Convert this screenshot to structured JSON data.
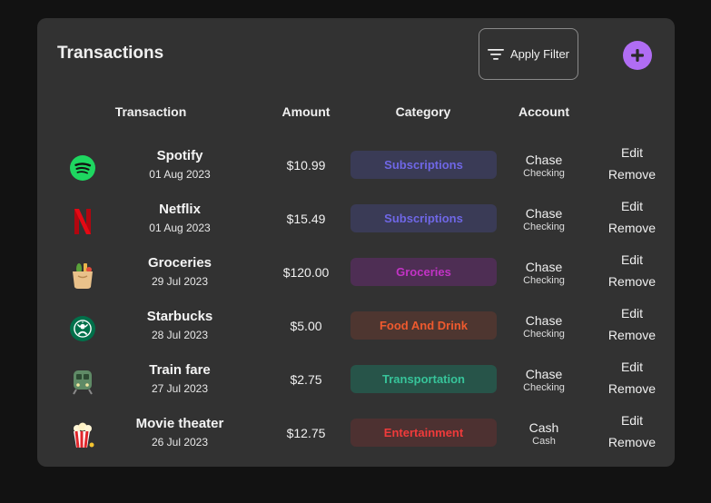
{
  "header": {
    "title": "Transactions",
    "filter_label": "Apply Filter",
    "filter_icon": "filter-lines-icon",
    "add_icon": "plus-icon"
  },
  "columns": {
    "transaction": "Transaction",
    "amount": "Amount",
    "category": "Category",
    "account": "Account"
  },
  "actions": {
    "edit": "Edit",
    "remove": "Remove"
  },
  "colors": {
    "card": "#323232",
    "accent_add": "#b06df3",
    "subscriptions_bg": "#3a3b56",
    "subscriptions_fg": "#6f67e6",
    "groceries_bg": "#4e2e54",
    "groceries_fg": "#c233c5",
    "food_bg": "#4e3630",
    "food_fg": "#ef5a2e",
    "transport_bg": "#275449",
    "transport_fg": "#37c49a",
    "entertainment_bg": "#4d3131",
    "entertainment_fg": "#ef3b3b"
  },
  "transactions": [
    {
      "name": "Spotify",
      "date": "01 Aug 2023",
      "amount": "$10.99",
      "category": "Subscriptions",
      "account": "Chase",
      "account_type": "Checking",
      "icon": "spotify-logo-icon"
    },
    {
      "name": "Netflix",
      "date": "01 Aug 2023",
      "amount": "$15.49",
      "category": "Subscriptions",
      "account": "Chase",
      "account_type": "Checking",
      "icon": "netflix-logo-icon"
    },
    {
      "name": "Groceries",
      "date": "29 Jul 2023",
      "amount": "$120.00",
      "category": "Groceries",
      "account": "Chase",
      "account_type": "Checking",
      "icon": "grocery-bag-icon"
    },
    {
      "name": "Starbucks",
      "date": "28 Jul 2023",
      "amount": "$5.00",
      "category": "Food And Drink",
      "account": "Chase",
      "account_type": "Checking",
      "icon": "starbucks-logo-icon"
    },
    {
      "name": "Train fare",
      "date": "27 Jul 2023",
      "amount": "$2.75",
      "category": "Transportation",
      "account": "Chase",
      "account_type": "Checking",
      "icon": "train-icon"
    },
    {
      "name": "Movie theater",
      "date": "26 Jul 2023",
      "amount": "$12.75",
      "category": "Entertainment",
      "account": "Cash",
      "account_type": "Cash",
      "icon": "popcorn-icon"
    }
  ]
}
